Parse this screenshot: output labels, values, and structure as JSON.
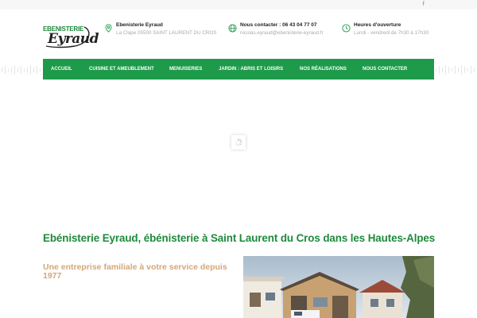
{
  "topbar": {
    "social_icon": "facebook-icon",
    "social_glyph": "f"
  },
  "logo": {
    "line1": "EBENISTERIE",
    "line2": "Eyraud"
  },
  "contact": {
    "company": {
      "icon": "map-pin-icon",
      "title": "Ebenisterie Eyraud",
      "subtitle": "La Clape 05500 SAINT LAURENT DU CROS"
    },
    "phone": {
      "icon": "globe-icon",
      "title": "Nous contacter : 06 43 04 77 07",
      "subtitle": "nicolas.eyraud@ebenisterie-eyraud.fr"
    },
    "hours": {
      "icon": "clock-icon",
      "title": "Heures d'ouverture",
      "subtitle": "Lundi - vendredi de 7h30 à 17h30"
    }
  },
  "nav": {
    "items": [
      {
        "label": "Accueil"
      },
      {
        "label": "Cuisine et ameublement"
      },
      {
        "label": "Menuiseries"
      },
      {
        "label": "Jardin : abris et loisirs"
      },
      {
        "label": "Nos réalisations"
      },
      {
        "label": "Nous contacter"
      }
    ]
  },
  "main": {
    "heading": "Ebénisterie Eyraud, ébénisterie à Saint Laurent du Cros dans les Hautes-Alpes",
    "subheading": "Une entreprise familiale à votre service depuis 1977"
  },
  "colors": {
    "brand_green": "#1d9a4a",
    "heading_green": "#1e8a3c",
    "subheading_tan": "#d4a776"
  }
}
